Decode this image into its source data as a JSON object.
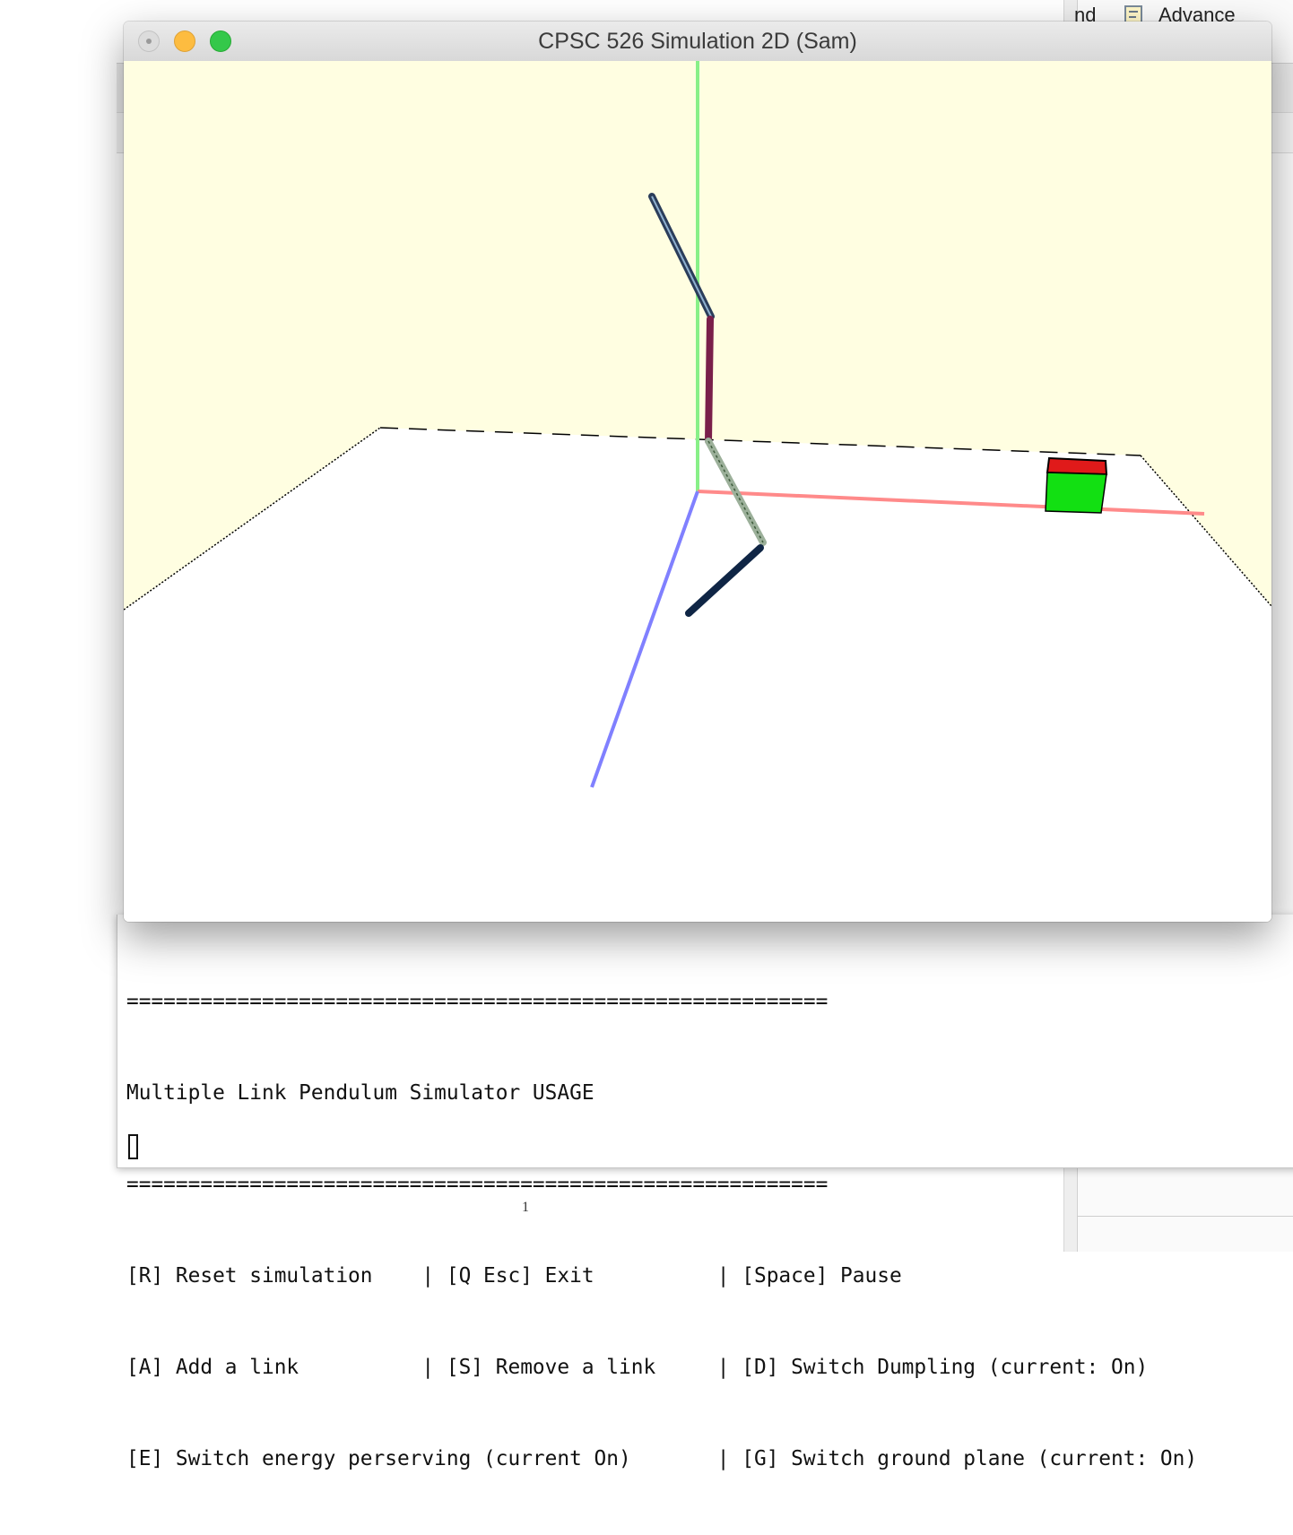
{
  "background_app": {
    "toolbar_fragment_left": "nd",
    "toolbar_fragment_right": "Advance",
    "page_number": "1"
  },
  "window": {
    "title": "CPSC 526 Simulation 2D (Sam)",
    "traffic_lights": [
      "close-button",
      "minimize-button",
      "zoom-button"
    ]
  },
  "scene": {
    "background_color": "#fffee1",
    "ground_color": "#ffffff",
    "axis_colors": {
      "x": "#ff8a8a",
      "y": "#88f088",
      "z": "#8080ff"
    },
    "link_colors": [
      "#2b3d5a",
      "#7a1f4a",
      "#9cb09a",
      "#0f2545"
    ],
    "box_colors": {
      "top": "#e01a1a",
      "body": "#12e012"
    }
  },
  "terminal": {
    "lines": [
      "=========================================================",
      "Multiple Link Pendulum Simulator USAGE",
      "=========================================================",
      "[R] Reset simulation    | [Q Esc] Exit          | [Space] Pause",
      "[A] Add a link          | [S] Remove a link     | [D] Switch Dumpling (current: On)",
      "[E] Switch energy perserving (current On)       | [G] Switch ground plane (current: On)"
    ]
  }
}
